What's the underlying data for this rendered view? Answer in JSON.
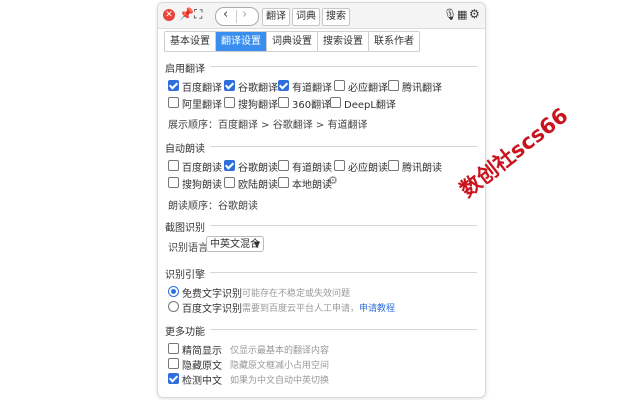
{
  "titlebar": {
    "tabs": [
      "翻译",
      "词典",
      "搜索"
    ]
  },
  "settings_tabs": [
    "基本设置",
    "翻译设置",
    "词典设置",
    "搜索设置",
    "联系作者"
  ],
  "enable_translate": {
    "title": "启用翻译",
    "items": [
      {
        "label": "百度翻译",
        "checked": true
      },
      {
        "label": "谷歌翻译",
        "checked": true
      },
      {
        "label": "有道翻译",
        "checked": true
      },
      {
        "label": "必应翻译",
        "checked": false
      },
      {
        "label": "腾讯翻译",
        "checked": false
      },
      {
        "label": "阿里翻译",
        "checked": false
      },
      {
        "label": "搜狗翻译",
        "checked": false
      },
      {
        "label": "360翻译",
        "checked": false
      },
      {
        "label": "DeepL翻译",
        "checked": false
      }
    ],
    "order_text": "展示顺序：百度翻译 > 谷歌翻译 > 有道翻译"
  },
  "auto_read": {
    "title": "自动朗读",
    "items": [
      {
        "label": "百度朗读",
        "checked": false
      },
      {
        "label": "谷歌朗读",
        "checked": true
      },
      {
        "label": "有道朗读",
        "checked": false
      },
      {
        "label": "必应朗读",
        "checked": false
      },
      {
        "label": "腾讯朗读",
        "checked": false
      },
      {
        "label": "搜狗朗读",
        "checked": false
      },
      {
        "label": "欧陆朗读",
        "checked": false
      },
      {
        "label": "本地朗读",
        "checked": false
      }
    ],
    "order_text": "朗读顺序：谷歌朗读"
  },
  "ocr": {
    "title": "截图识别",
    "lang_label": "识别语言",
    "lang_value": "中英文混合"
  },
  "engine": {
    "title": "识别引擎",
    "options": [
      {
        "label": "免费文字识别",
        "hint": "可能存在不稳定或失效问题",
        "selected": true
      },
      {
        "label": "百度文字识别",
        "hint": "需要到百度云平台人工申请，",
        "link": "申请教程",
        "selected": false
      }
    ]
  },
  "more": {
    "title": "更多功能",
    "items": [
      {
        "label": "精简显示",
        "hint": "仅显示最基本的翻译内容",
        "checked": false
      },
      {
        "label": "隐藏原文",
        "hint": "隐藏原文框减小占用空间",
        "checked": false
      },
      {
        "label": "检测中文",
        "hint": "如果为中文自动中英切换",
        "checked": true
      }
    ]
  },
  "watermark": "数创社scs66"
}
